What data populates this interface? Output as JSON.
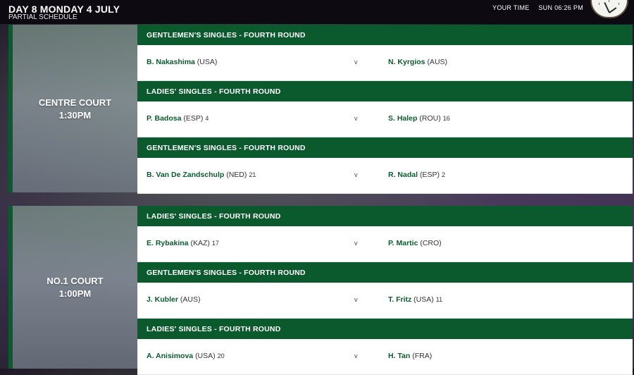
{
  "header": {
    "title": "DAY 8 MONDAY 4 JULY",
    "subtitle": "PARTIAL SCHEDULE",
    "your_time_label": "YOUR TIME",
    "your_time_value": "SUN 06:26 PM"
  },
  "courts": [
    {
      "name": "CENTRE COURT",
      "time": "1:30PM",
      "matches": [
        {
          "round": "GENTLEMEN'S SINGLES - FOURTH ROUND",
          "p1": {
            "name": "B. Nakashima",
            "country": "(USA)",
            "seed": ""
          },
          "vs": "v",
          "p2": {
            "name": "N. Kyrgios",
            "country": "(AUS)",
            "seed": ""
          }
        },
        {
          "round": "LADIES' SINGLES - FOURTH ROUND",
          "p1": {
            "name": "P. Badosa",
            "country": "(ESP)",
            "seed": "4"
          },
          "vs": "v",
          "p2": {
            "name": "S. Halep",
            "country": "(ROU)",
            "seed": "16"
          }
        },
        {
          "round": "GENTLEMEN'S SINGLES - FOURTH ROUND",
          "p1": {
            "name": "B. Van De Zandschulp",
            "country": "(NED)",
            "seed": "21"
          },
          "vs": "v",
          "p2": {
            "name": "R. Nadal",
            "country": "(ESP)",
            "seed": "2"
          }
        }
      ]
    },
    {
      "name": "NO.1 COURT",
      "time": "1:00PM",
      "matches": [
        {
          "round": "LADIES' SINGLES - FOURTH ROUND",
          "p1": {
            "name": "E. Rybakina",
            "country": "(KAZ)",
            "seed": "17"
          },
          "vs": "v",
          "p2": {
            "name": "P. Martic",
            "country": "(CRO)",
            "seed": ""
          }
        },
        {
          "round": "GENTLEMEN'S SINGLES - FOURTH ROUND",
          "p1": {
            "name": "J. Kubler",
            "country": "(AUS)",
            "seed": ""
          },
          "vs": "v",
          "p2": {
            "name": "T. Fritz",
            "country": "(USA)",
            "seed": "11"
          }
        },
        {
          "round": "LADIES' SINGLES - FOURTH ROUND",
          "p1": {
            "name": "A. Anisimova",
            "country": "(USA)",
            "seed": "20"
          },
          "vs": "v",
          "p2": {
            "name": "H. Tan",
            "country": "(FRA)",
            "seed": ""
          }
        }
      ]
    }
  ],
  "colors": {
    "accent_green": "#0b5a2e",
    "header_bg": "#0e0a12"
  }
}
